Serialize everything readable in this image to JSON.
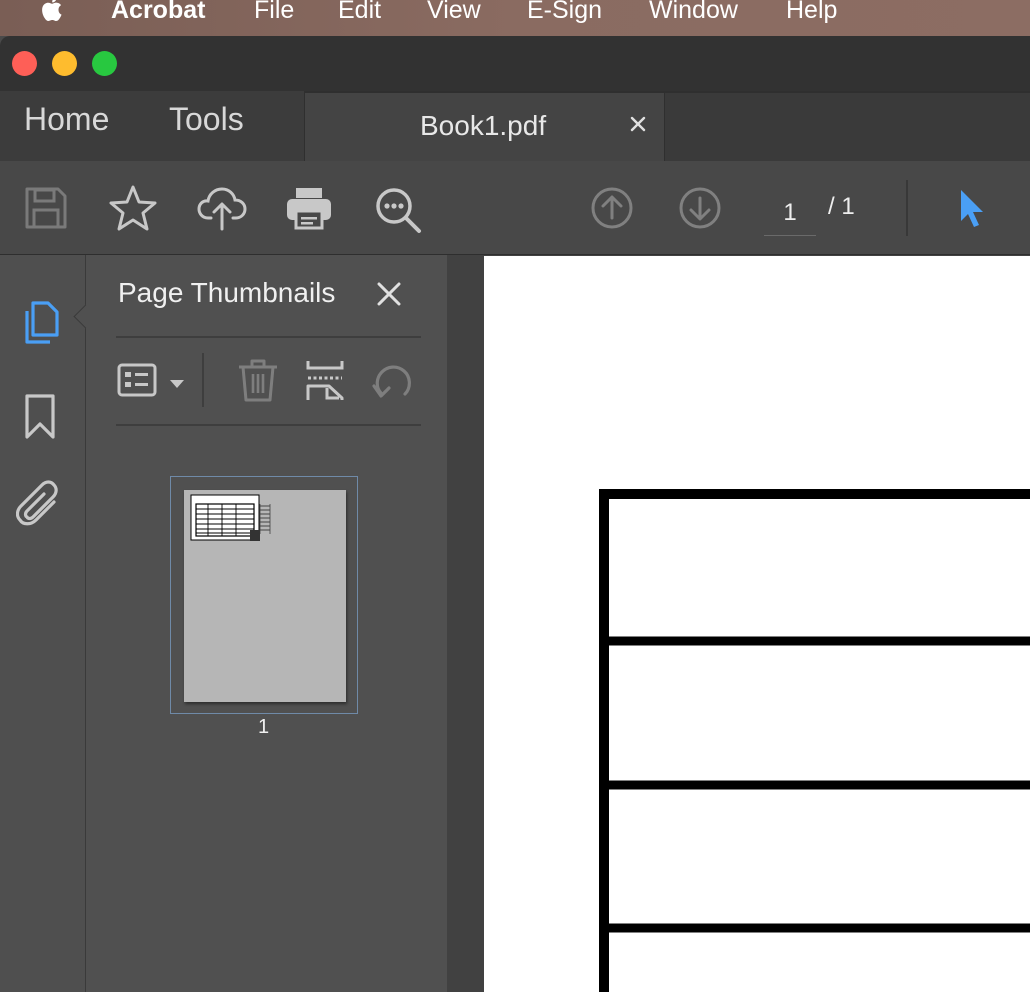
{
  "menubar": {
    "items": [
      "Acrobat",
      "File",
      "Edit",
      "View",
      "E-Sign",
      "Window",
      "Help"
    ]
  },
  "tabs": {
    "home": "Home",
    "tools": "Tools",
    "document": "Book1.pdf"
  },
  "toolbar": {
    "page_current": "1",
    "page_total_label": "/ 1"
  },
  "panel": {
    "title": "Page Thumbnails",
    "thumbnail_label": "1"
  },
  "colors": {
    "accent": "#4a9ff5",
    "close_red": "#fe5f57",
    "minimize_yellow": "#febc2e",
    "zoom_green": "#28c840"
  }
}
